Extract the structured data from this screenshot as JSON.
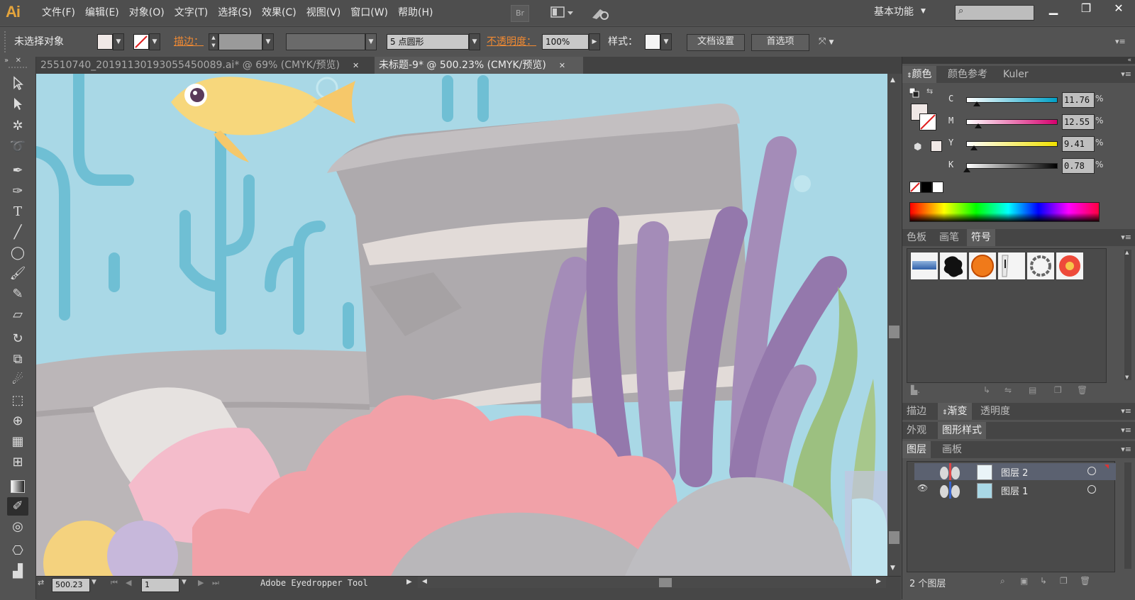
{
  "app": {
    "logo": "Ai"
  },
  "menubar": {
    "items": [
      "文件(F)",
      "编辑(E)",
      "对象(O)",
      "文字(T)",
      "选择(S)",
      "效果(C)",
      "视图(V)",
      "窗口(W)",
      "帮助(H)"
    ],
    "bridge_label": "Br",
    "workspace": "基本功能",
    "search_placeholder": ""
  },
  "controlbar": {
    "selection_status": "未选择对象",
    "fill_color": "#f0e8e6",
    "stroke_label": "描边：",
    "brush_label": "5 点圆形",
    "opacity_label": "不透明度：",
    "opacity_value": "100%",
    "style_label": "样式：",
    "doc_setup": "文档设置",
    "preferences": "首选项"
  },
  "tabs": [
    {
      "label": "25510740_20191130193055450089.ai* @ 69% (CMYK/预览)",
      "active": false
    },
    {
      "label": "未标题-9* @ 500.23% (CMYK/预览)",
      "active": true
    }
  ],
  "tools": [
    "selection-tool",
    "direct-selection-tool",
    "magic-wand-tool",
    "lasso-tool",
    "pen-tool",
    "curvature-tool",
    "type-tool",
    "line-segment-tool",
    "ellipse-tool",
    "paintbrush-tool",
    "pencil-tool",
    "eraser-tool",
    "rotate-tool",
    "scale-tool",
    "warp-tool",
    "free-transform-tool",
    "shape-builder-tool",
    "graph-tool",
    "mesh-tool",
    "gradient-tool",
    "eyedropper-tool",
    "blend-tool",
    "symbol-sprayer-tool",
    "column-graph-tool"
  ],
  "statusbar": {
    "zoom": "500.23",
    "artboard": "1",
    "tool_name": "Adobe Eyedropper Tool"
  },
  "color_panel": {
    "tabs": [
      "颜色",
      "颜色参考",
      "Kuler"
    ],
    "sliders": [
      {
        "label": "C",
        "value": "11.76",
        "fraction": 0.12,
        "from": "#ffffff",
        "to": "#00a0c6"
      },
      {
        "label": "M",
        "value": "12.55",
        "fraction": 0.13,
        "from": "#ffffff",
        "to": "#d6006e"
      },
      {
        "label": "Y",
        "value": "9.41",
        "fraction": 0.09,
        "from": "#ffffff",
        "to": "#f0e000"
      },
      {
        "label": "K",
        "value": "0.78",
        "fraction": 0.01,
        "from": "#ffffff",
        "to": "#000000"
      }
    ],
    "percent": "%"
  },
  "symbols_panel": {
    "tabs": [
      "色板",
      "画笔",
      "符号"
    ],
    "symbols": [
      "blue-banner-symbol",
      "ink-splat-symbol",
      "orange-dot-symbol",
      "torn-paper-symbol",
      "chain-ring-symbol",
      "red-flower-symbol"
    ]
  },
  "gradient_panel": {
    "tabs": [
      "描边",
      "渐变",
      "透明度"
    ]
  },
  "appearance_panel": {
    "tabs": [
      "外观",
      "图形样式"
    ]
  },
  "layers_panel": {
    "tabs": [
      "图层",
      "画板"
    ],
    "layers": [
      {
        "name": "图层 2",
        "selected": true
      },
      {
        "name": "图层 1",
        "selected": false
      }
    ],
    "count": "2 个图层"
  }
}
